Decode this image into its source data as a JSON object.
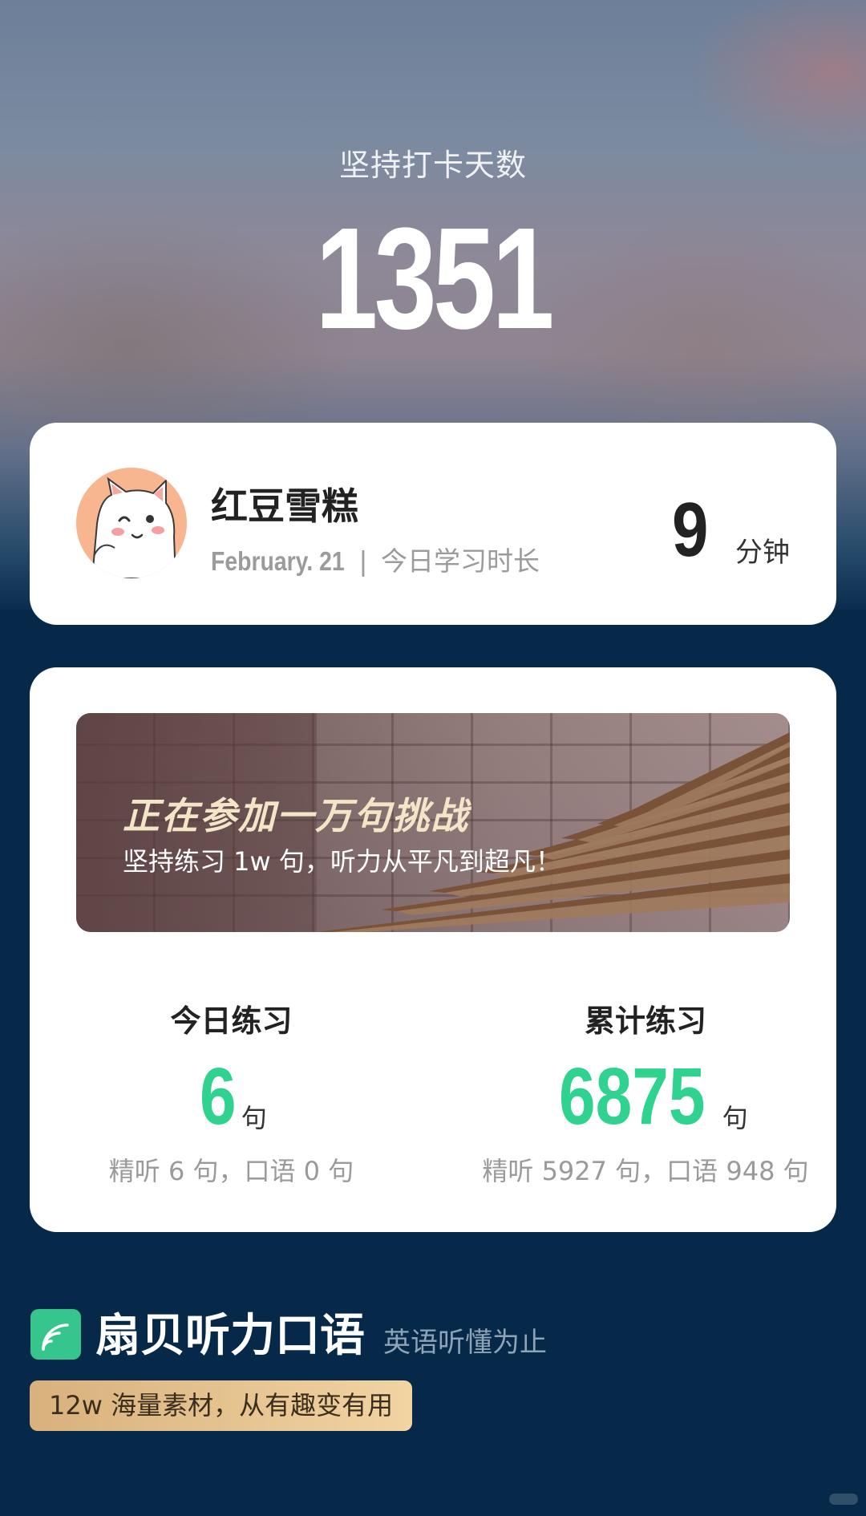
{
  "streak": {
    "label": "坚持打卡天数",
    "days": "1351"
  },
  "user": {
    "name": "红豆雪糕",
    "date": "February. 21",
    "separator": "|",
    "study_label": "今日学习时长",
    "minutes": "9",
    "minutes_unit": "分钟"
  },
  "challenge_banner": {
    "title": "正在参加一万句挑战",
    "subtitle": "坚持练习 1w 句，听力从平凡到超凡！"
  },
  "stats": {
    "today": {
      "title": "今日练习",
      "value": "6",
      "unit": "句",
      "detail": "精听 6 句，口语 0 句"
    },
    "total": {
      "title": "累计练习",
      "value": "6875",
      "unit": "句",
      "detail": "精听 5927 句，口语 948 句"
    }
  },
  "brand": {
    "name": "扇贝听力口语",
    "slogan": "英语听懂为止",
    "tagline": "12w 海量素材，从有趣变有用"
  },
  "colors": {
    "accent_green": "#2fd28f",
    "page_bg": "#06294a",
    "banner_title": "#f5e5c7",
    "pill_gold": "#e5c28e"
  }
}
